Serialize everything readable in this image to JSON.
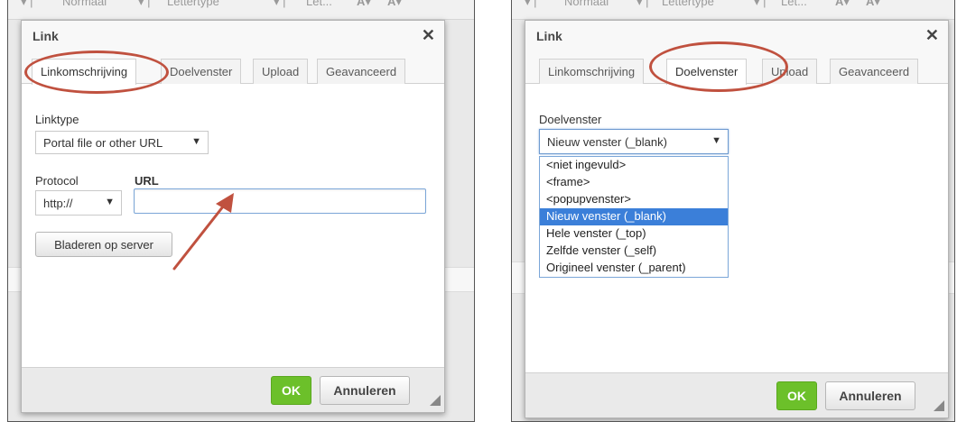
{
  "background": {
    "toolbar_texts": [
      "Normaal",
      "Lettertype",
      "Let...",
      "A",
      "A"
    ]
  },
  "left": {
    "dialog": {
      "title": "Link",
      "close_glyph": "✕",
      "tabs": [
        "Linkomschrijving",
        "Doelvenster",
        "Upload",
        "Geavanceerd"
      ],
      "active_tab": 0,
      "linktype_label": "Linktype",
      "linktype_value": "Portal file or other URL",
      "protocol_label": "Protocol",
      "protocol_value": "http://",
      "url_label": "URL",
      "url_value": "",
      "browse_button": "Bladeren op server",
      "ok_label": "OK",
      "cancel_label": "Annuleren"
    },
    "annotation": {
      "ring_target": "tab-linkomschrijving",
      "arrow_target": "url-input",
      "color": "#c0513f"
    }
  },
  "right": {
    "dialog": {
      "title": "Link",
      "close_glyph": "✕",
      "tabs": [
        "Linkomschrijving",
        "Doelvenster",
        "Upload",
        "Geavanceerd"
      ],
      "active_tab": 1,
      "target_label": "Doelvenster",
      "target_value": "Nieuw venster (_blank)",
      "options": [
        "<niet ingevuld>",
        "<frame>",
        "<popupvenster>",
        "Nieuw venster (_blank)",
        "Hele venster (_top)",
        "Zelfde venster (_self)",
        "Origineel venster (_parent)"
      ],
      "selected_option": 3,
      "ok_label": "OK",
      "cancel_label": "Annuleren"
    },
    "annotation": {
      "ring_target": "tab-doelvenster",
      "color": "#c0513f"
    }
  },
  "colors": {
    "ok_green": "#6cc02a",
    "selection_blue": "#3b7fd9",
    "focus_blue": "#7ba6d8",
    "annotation_red": "#c0513f"
  }
}
